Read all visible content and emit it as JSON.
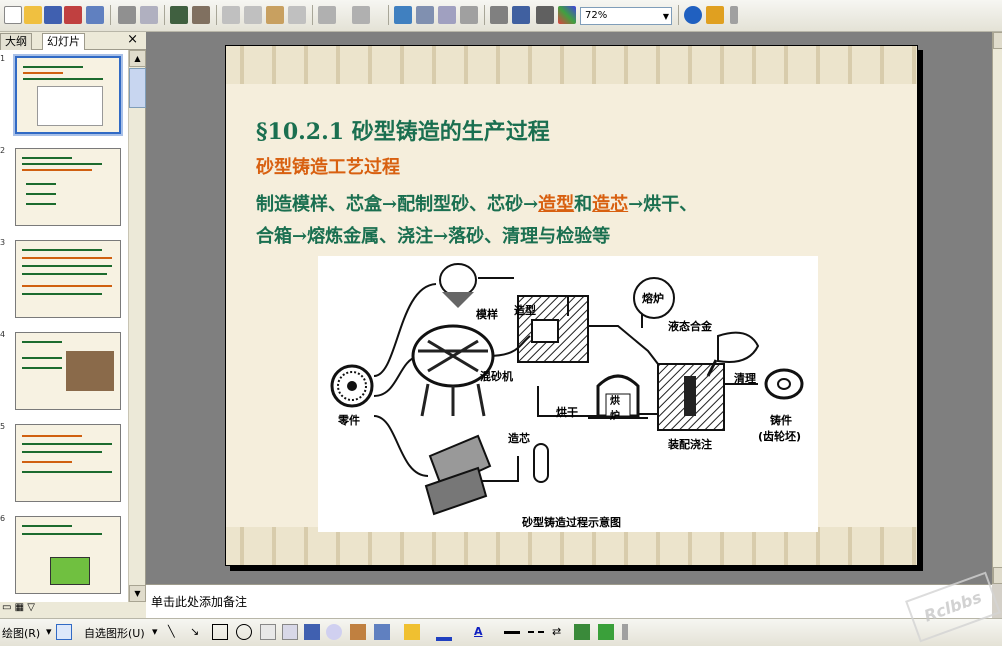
{
  "toolbar": {
    "zoom_value": "72%"
  },
  "pane": {
    "tabs": [
      {
        "label": "大纲"
      },
      {
        "label": "幻灯片"
      }
    ],
    "close_glyph": "×"
  },
  "thumbnails": [
    {
      "number": "1"
    },
    {
      "number": "2"
    },
    {
      "number": "3"
    },
    {
      "number": "4"
    },
    {
      "number": "5"
    },
    {
      "number": "6"
    }
  ],
  "slide": {
    "title": "§10.2.1  砂型铸造的生产过程",
    "subtitle": "砂型铸造工艺过程",
    "line1_a": "制造模样、芯盒→配制型砂、芯砂→",
    "line1_b": "造型",
    "line1_c": "和",
    "line1_d": "造芯",
    "line1_e": "→烘干、",
    "line2": "合箱→熔炼金属、浇注→落砂、清理与检验等",
    "diagram": {
      "labels": {
        "moyang": "模样",
        "zaoxing": "造型",
        "luzhu": "熔炉",
        "yetaihejin": "液态合金",
        "hunshaji": "混砂机",
        "lingjian": "零件",
        "honggan": "烘干",
        "honglu": "烘\n炉",
        "qingli": "清理",
        "zhujian": "铸件",
        "chilunpi": "(齿轮坯)",
        "zhuangpeijiaozhu": "装配浇注",
        "zaoxin": "造芯",
        "caption": "砂型铸造过程示意图"
      }
    }
  },
  "notes": {
    "placeholder": "单击此处添加备注"
  },
  "drawbar": {
    "draw_label": "绘图(R)",
    "autoshapes_label": "自选图形(U)"
  },
  "watermark": "Rclbbs",
  "colors": {
    "title_green": "#1a6f50",
    "accent_orange": "#d86010",
    "selection_blue": "#316ac5"
  }
}
